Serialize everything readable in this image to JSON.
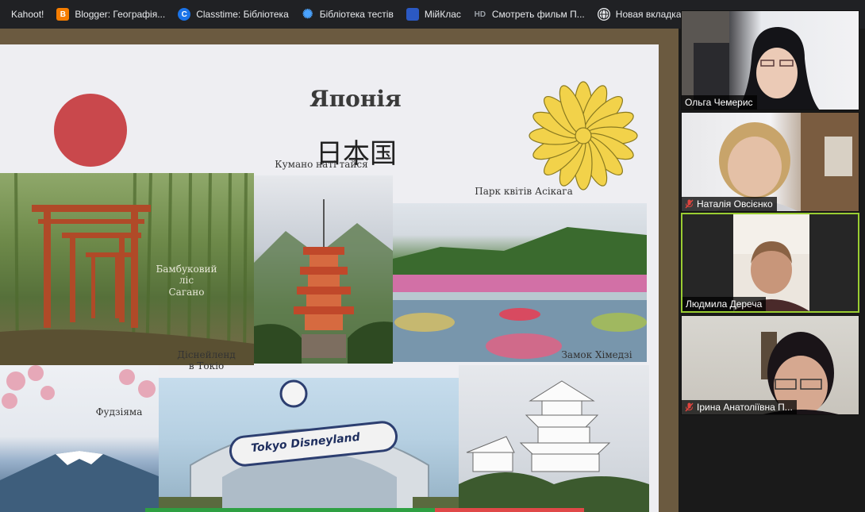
{
  "bookmarks": [
    {
      "label": "Kahoot!",
      "icon": "none"
    },
    {
      "label": "Blogger: Географія...",
      "icon": "blogger-icon",
      "mark": "B"
    },
    {
      "label": "Classtime: Бібліотека",
      "icon": "classtime-icon",
      "mark": "C"
    },
    {
      "label": "Бібліотека тестів",
      "icon": "test-library-icon",
      "mark": "✺"
    },
    {
      "label": "МійКлас",
      "icon": "myclass-icon",
      "mark": "▬"
    },
    {
      "label": "Смотреть фильм П...",
      "icon": "hd-icon",
      "mark": "HD"
    },
    {
      "label": "Новая вкладка",
      "icon": "globe-icon",
      "mark": "◍"
    }
  ],
  "poster": {
    "title": "Японія",
    "kanji": "日本国",
    "captions": {
      "bamboo": "Бамбуковий ліс\nСагано",
      "kumano": "Кумано наті тайся",
      "ashikaga": "Парк квітів Асікага",
      "disney": "Діснейленд\nв Токіо",
      "himeji": "Замок Хімедзі",
      "fuji": "Фудзіяма",
      "disney_sign": "Tokyo Disneyland"
    }
  },
  "participants": [
    {
      "name": "Ольга Чемерис",
      "muted": false
    },
    {
      "name": "Наталія Овсієнко",
      "muted": true
    },
    {
      "name": "Людмила Дереча",
      "muted": false,
      "active": true
    },
    {
      "name": "Ірина Анатоліївна П...",
      "muted": true
    }
  ],
  "colors": {
    "active_speaker": "#9acd32",
    "muted_mic": "#e0443e",
    "bookmarks_bg": "#202124"
  }
}
